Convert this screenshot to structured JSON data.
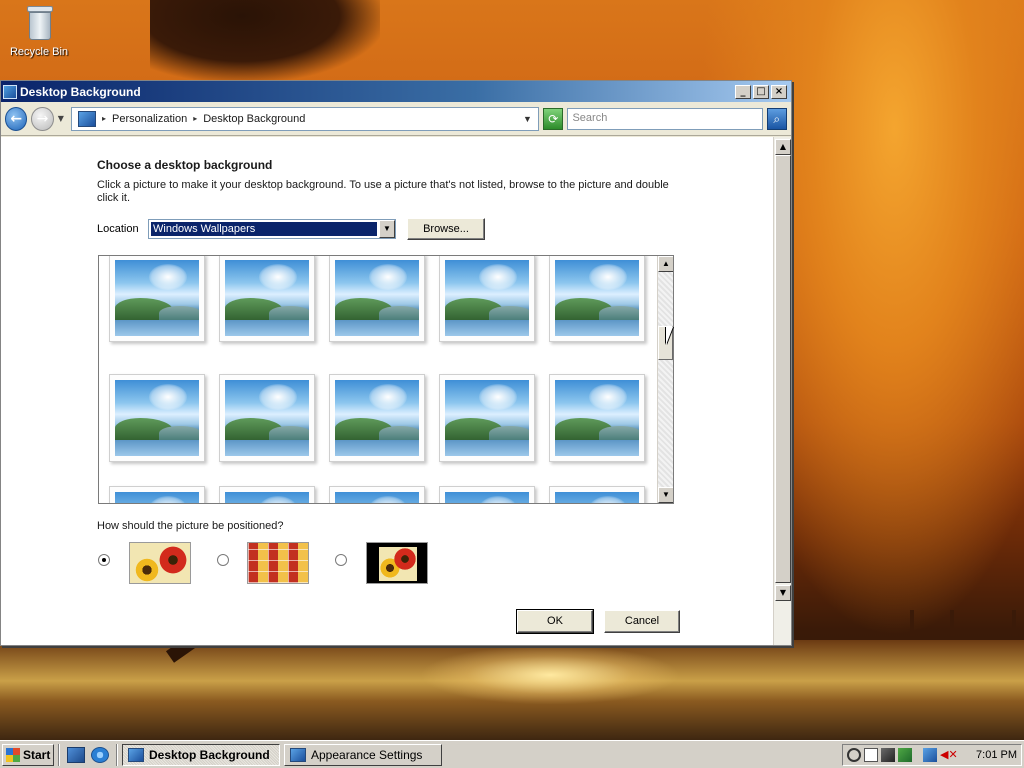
{
  "desktop": {
    "recycle_bin_label": "Recycle Bin"
  },
  "window": {
    "title": "Desktop Background",
    "controls": {
      "minimize": "_",
      "maximize": "□",
      "close": "×"
    },
    "address": {
      "crumbs": [
        "Personalization",
        "Desktop Background"
      ]
    },
    "search_placeholder": "Search"
  },
  "page": {
    "heading": "Choose a desktop background",
    "description": "Click a picture to make it your desktop background. To use a picture that's not listed, browse to the picture and double click it.",
    "location_label": "Location",
    "location_value": "Windows Wallpapers",
    "browse_label": "Browse...",
    "position_question": "How should the picture be positioned?",
    "position_options": [
      {
        "name": "center",
        "selected": true
      },
      {
        "name": "tile",
        "selected": false
      },
      {
        "name": "stretch",
        "selected": false
      }
    ],
    "ok_label": "OK",
    "cancel_label": "Cancel"
  },
  "gallery": {
    "thumbnail_icon": "lake-mountain-wallpaper",
    "rows_visible": 3,
    "columns": 5
  },
  "taskbar": {
    "start_label": "Start",
    "tasks": [
      {
        "label": "Desktop Background",
        "active": true
      },
      {
        "label": "Appearance Settings",
        "active": false
      }
    ],
    "clock": "7:01 PM"
  },
  "colors": {
    "title_gradient_start": "#0a246a",
    "title_gradient_end": "#a6caf0",
    "selection": "#0a246a",
    "face": "#d4d0c8"
  }
}
